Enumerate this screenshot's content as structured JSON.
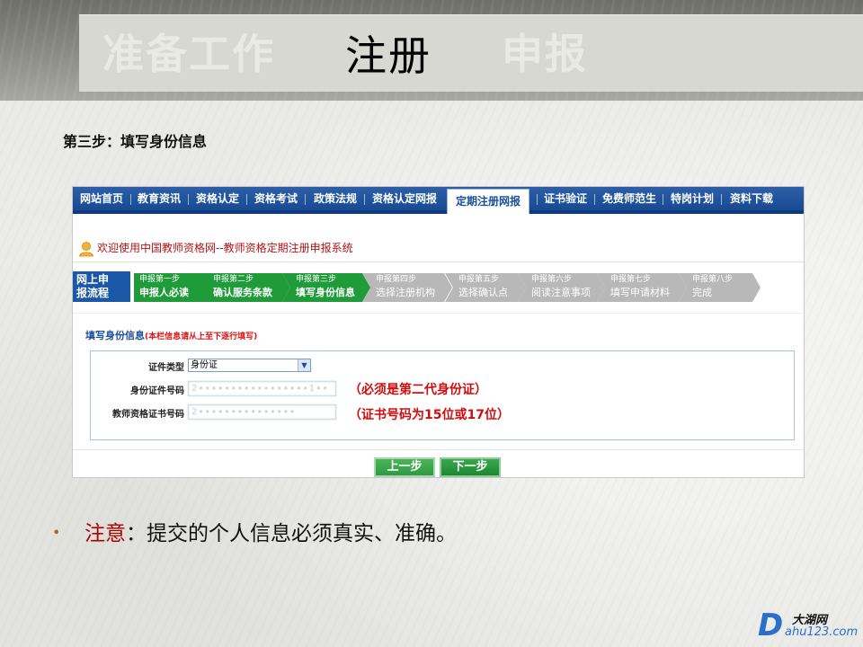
{
  "slide": {
    "title_tabs": [
      {
        "label": "准备工作",
        "active": false
      },
      {
        "label": "注册",
        "active": true
      },
      {
        "label": "申报",
        "active": false
      }
    ],
    "step_caption": "第三步：填写身份信息",
    "bullet_note_label": "注意",
    "bullet_note_text": "：提交的个人信息必须真实、准确。",
    "logo_cn": "大湖网",
    "logo_url": "ahu123.com",
    "logo_letter": "D"
  },
  "site": {
    "nav": [
      "网站首页",
      "教育资讯",
      "资格认定",
      "资格考试",
      "政策法规",
      "资格认定网报",
      "定期注册网报",
      "证书验证",
      "免费师范生",
      "特岗计划",
      "资料下载"
    ],
    "nav_active": "定期注册网报",
    "welcome_text": "欢迎使用中国教师资格网--教师资格定期注册申报系统",
    "flow_label_line1": "网上申",
    "flow_label_line2": "报流程",
    "flow_steps": [
      {
        "top": "申报第一步",
        "bottom": "申报人必读",
        "done": true
      },
      {
        "top": "申报第二步",
        "bottom": "确认服务条款",
        "done": true
      },
      {
        "top": "申报第三步",
        "bottom": "填写身份信息",
        "done": true
      },
      {
        "top": "申报第四步",
        "bottom": "选择注册机构",
        "done": false
      },
      {
        "top": "申报第五步",
        "bottom": "选择确认点",
        "done": false
      },
      {
        "top": "申报第六步",
        "bottom": "阅读注意事项",
        "done": false
      },
      {
        "top": "申报第七步",
        "bottom": "填写申请材料",
        "done": false
      },
      {
        "top": "申报第八步",
        "bottom": "完成",
        "done": false
      }
    ],
    "form": {
      "title": "填写身份信息",
      "title_note": "(本栏信息请从上至下逐行填写)",
      "id_type_label": "证件类型",
      "id_type_value": "身份证",
      "id_number_label": "身份证件号码",
      "id_number_value": "2∙∙∙∙∙∙∙∙∙∙∙∙∙∙∙∙∙1∙∙",
      "id_number_hint": "（必须是第二代身份证）",
      "cert_number_label": "教师资格证书号码",
      "cert_number_value": "2∙∙∙∙∙∙∙∙∙∙∙∙∙∙∙",
      "cert_number_hint": "（证书号码为15位或17位）",
      "prev_button": "上一步",
      "next_button": "下一步"
    }
  },
  "colors": {
    "nav_blue": "#174a92",
    "step_done": "#1f9b3a",
    "step_todo": "#b8b8b8",
    "hint_red": "#d10c0c",
    "note_red": "#b00000"
  }
}
